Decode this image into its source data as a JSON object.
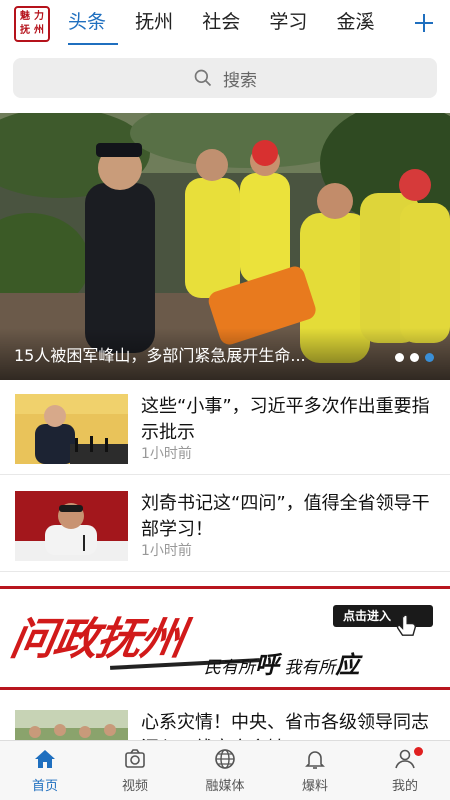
{
  "logo": {
    "chars": [
      "魅",
      "力",
      "抚",
      "州"
    ]
  },
  "tabs": [
    {
      "label": "头条",
      "active": true
    },
    {
      "label": "抚州",
      "active": false
    },
    {
      "label": "社会",
      "active": false
    },
    {
      "label": "学习",
      "active": false
    },
    {
      "label": "金溪",
      "active": false
    }
  ],
  "search": {
    "placeholder": "搜索"
  },
  "hero": {
    "caption": "15人被困军峰山，多部门紧急展开生命...",
    "dots": 3,
    "active_dot": 3
  },
  "news": [
    {
      "title": "这些“小事”，习近平多次作出重要指示批示",
      "time": "1小时前"
    },
    {
      "title": "刘奇书记这“四问”，值得全省领导干部学习！",
      "time": "1小时前"
    },
    {
      "title": "心系灾情！中央、省市各级领导同志深入一线率众乡镇..."
    }
  ],
  "banner": {
    "title": "问政抚州",
    "slogan_pre": "民有所",
    "slogan_hu": "呼",
    "slogan_mid": " 我有所",
    "slogan_ying": "应",
    "enter": "点击进入"
  },
  "bottom_nav": [
    {
      "label": "首页",
      "icon": "home-icon",
      "active": true
    },
    {
      "label": "视频",
      "icon": "camera-icon",
      "active": false
    },
    {
      "label": "融媒体",
      "icon": "globe-icon",
      "active": false
    },
    {
      "label": "爆料",
      "icon": "bell-icon",
      "active": false
    },
    {
      "label": "我的",
      "icon": "user-icon",
      "active": false,
      "badge": true
    }
  ],
  "colors": {
    "accent": "#1f6fbf",
    "brand_red": "#b8161e",
    "banner_red": "#d11a1a"
  }
}
